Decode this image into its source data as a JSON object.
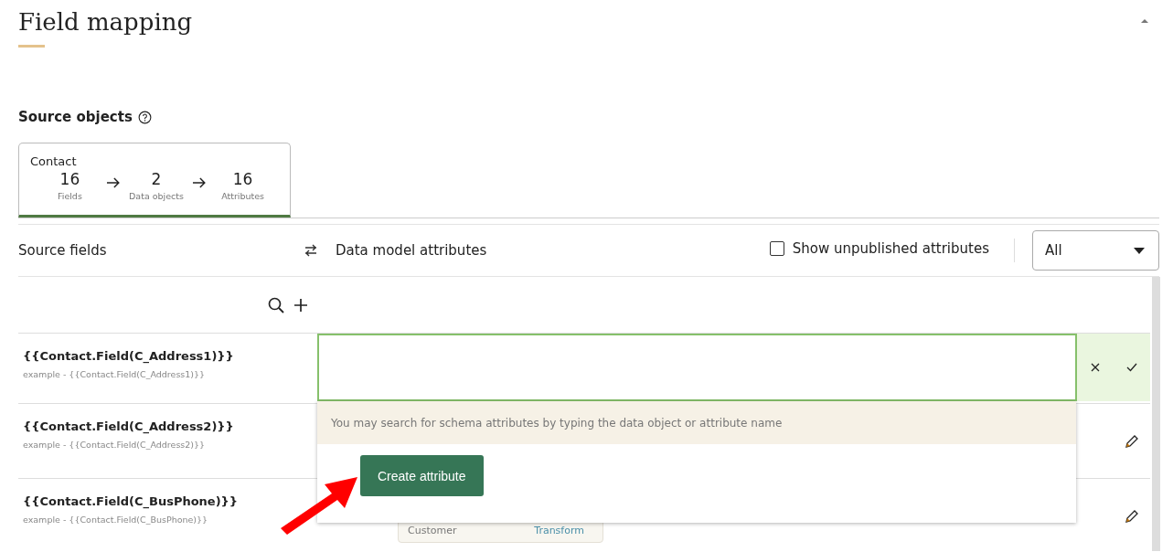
{
  "page": {
    "title": "Field mapping",
    "collapsed": false
  },
  "source_objects": {
    "title": "Source objects"
  },
  "tabs": [
    {
      "name": "Contact",
      "selected": true,
      "stats": [
        {
          "value": "16",
          "label": "Fields"
        },
        {
          "value": "2",
          "label": "Data objects"
        },
        {
          "value": "16",
          "label": "Attributes"
        }
      ]
    }
  ],
  "toolbar": {
    "source_label": "Source fields",
    "target_label": "Data model attributes",
    "show_unpublished": {
      "label": "Show unpublished attributes",
      "checked": false
    },
    "filter": {
      "value": "All"
    }
  },
  "rows": [
    {
      "field": "{{Contact.Field(C_Address1)}}",
      "example": "example - {{Contact.Field(C_Address1)}}",
      "kind": "editing"
    },
    {
      "field": "{{Contact.Field(C_Address2)}}",
      "example": "example - {{Contact.Field(C_Address2)}}",
      "kind": "view"
    },
    {
      "field": "{{Contact.Field(C_BusPhone)}}",
      "example": "example - {{Contact.Field(C_BusPhone)}}",
      "kind": "view",
      "mapping": {
        "object": "Customer",
        "action": "Transform"
      }
    }
  ],
  "dropdown": {
    "hint": "You may search for schema attributes by typing the data object or attribute name",
    "button": "Create attribute"
  }
}
